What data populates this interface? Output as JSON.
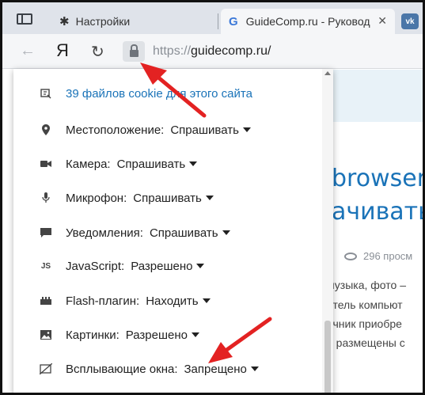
{
  "tabs": {
    "settings_label": "Настройки",
    "active_label": "GuideComp.ru - Руковод",
    "active_favicon": "G",
    "vk_label": "vk"
  },
  "toolbar": {
    "yandex_label": "Я",
    "url_protocol": "https://",
    "url_host": "guidecomp.ru/"
  },
  "page": {
    "headline_line1": "browser",
    "headline_line2": "ачивать?",
    "views": "296 просм",
    "lines": [
      "музыка, фото –",
      "атель компьют",
      "очник приобре",
      "е размещены с"
    ]
  },
  "panel": {
    "cookies": "39 файлов cookie для этого сайта",
    "permissions": [
      {
        "icon": "location-pin-icon",
        "label": "Местоположение:",
        "value": "Спрашивать"
      },
      {
        "icon": "camera-icon",
        "label": "Камера:",
        "value": "Спрашивать"
      },
      {
        "icon": "microphone-icon",
        "label": "Микрофон:",
        "value": "Спрашивать"
      },
      {
        "icon": "notification-icon",
        "label": "Уведомления:",
        "value": "Спрашивать"
      },
      {
        "icon": "javascript-icon",
        "label": "JavaScript:",
        "value": "Разрешено"
      },
      {
        "icon": "plugin-icon",
        "label": "Flash-плагин:",
        "value": "Находить"
      },
      {
        "icon": "image-icon",
        "label": "Картинки:",
        "value": "Разрешено"
      },
      {
        "icon": "popup-blocked-icon",
        "label": "Всплывающие окна:",
        "value": "Запрещено"
      }
    ],
    "js_icon_text": "JS"
  },
  "colors": {
    "link": "#1a73b8",
    "annotation_arrow": "#e32222"
  }
}
